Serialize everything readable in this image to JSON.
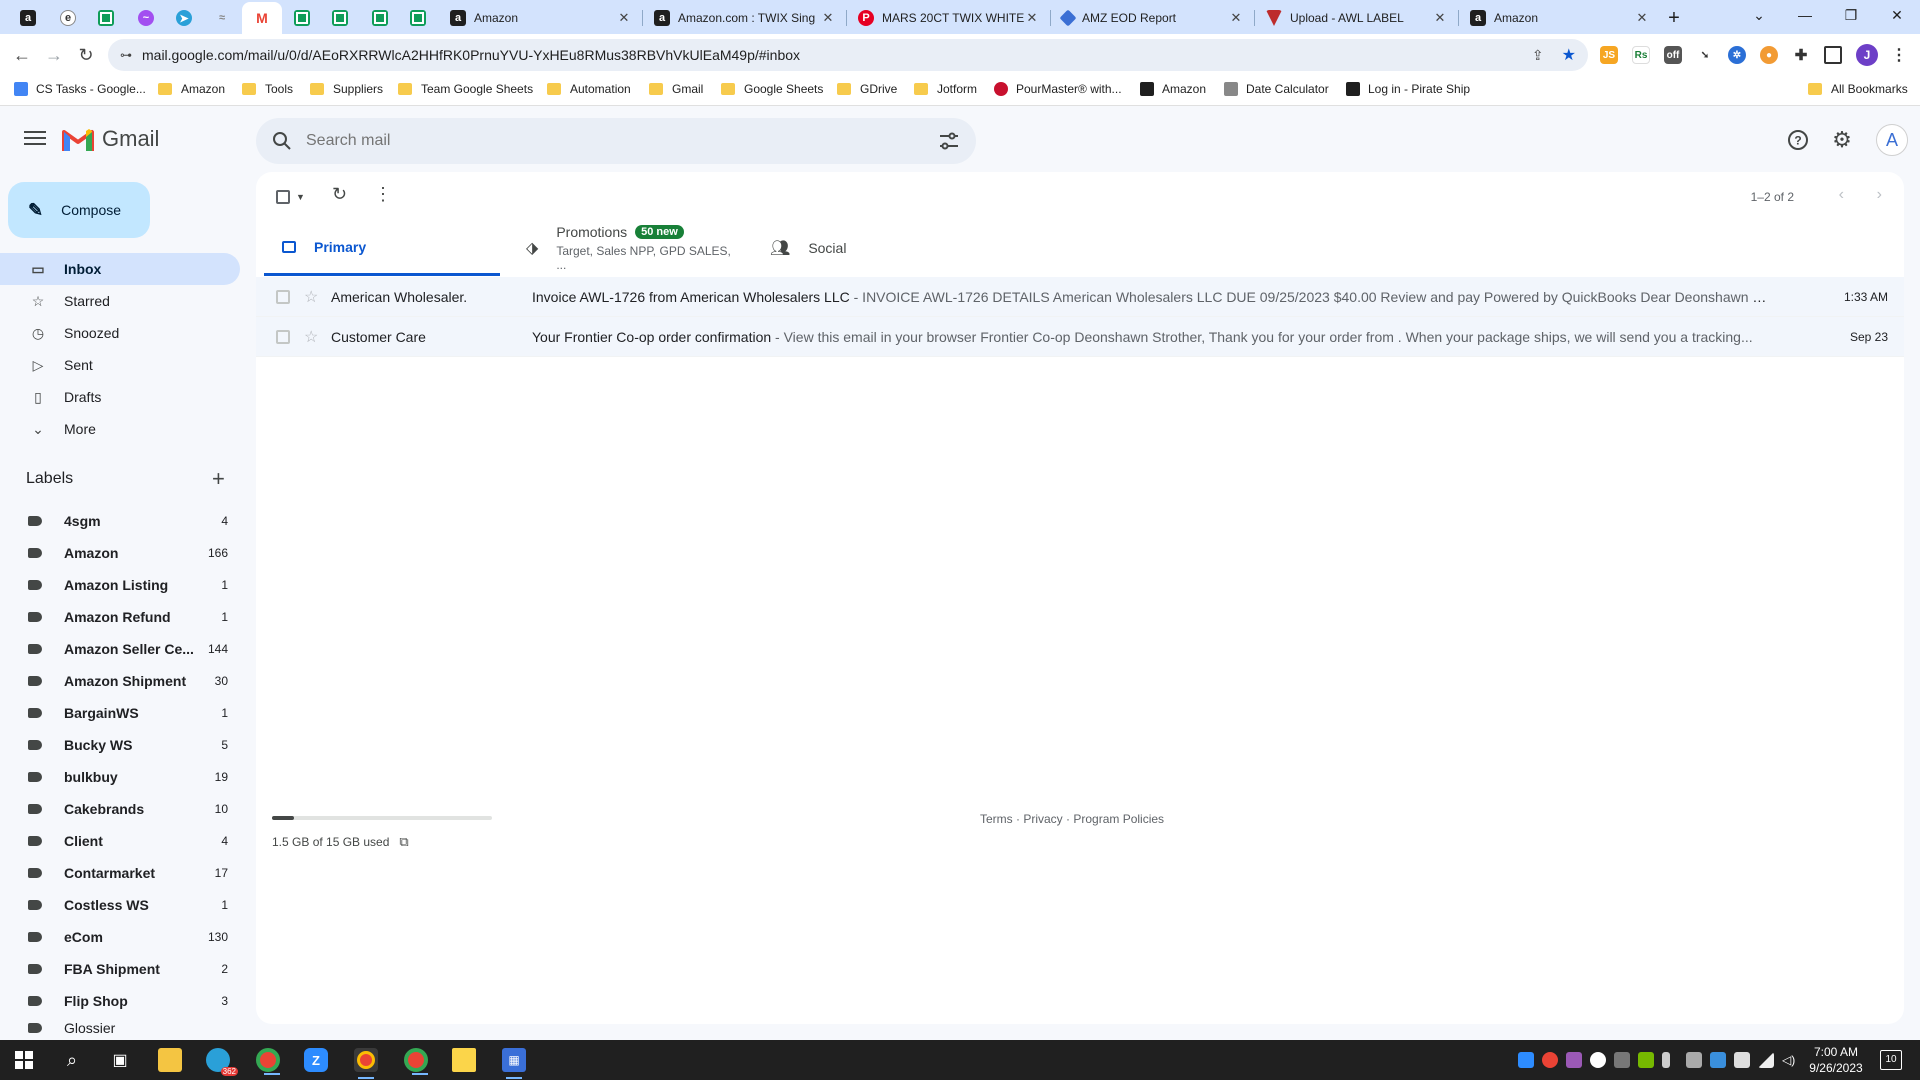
{
  "browser": {
    "tabs": [
      {
        "title": "Amazon",
        "icon": "amazon-icon"
      },
      {
        "title": "Amazon.com : TWIX Sing",
        "icon": "amazon-icon"
      },
      {
        "title": "MARS 20CT TWIX WHITE",
        "icon": "pinterest-icon"
      },
      {
        "title": "AMZ EOD Report",
        "icon": "amz-icon"
      },
      {
        "title": "Upload - AWL LABEL",
        "icon": "webform-icon"
      },
      {
        "title": "Amazon",
        "icon": "amazon-icon"
      }
    ],
    "url": "mail.google.com/mail/u/0/d/AEoRXRRWlcA2HHfRK0PrnuYVU-YxHEu8RMus38RBVhVkUlEaM49p/#inbox",
    "profile_initial": "J",
    "bookmarks": [
      {
        "label": "CS Tasks - Google...",
        "kind": "doc"
      },
      {
        "label": "Amazon",
        "kind": "folder"
      },
      {
        "label": "Tools",
        "kind": "folder"
      },
      {
        "label": "Suppliers",
        "kind": "folder"
      },
      {
        "label": "Team Google Sheets",
        "kind": "folder"
      },
      {
        "label": "Automation",
        "kind": "folder"
      },
      {
        "label": "Gmail",
        "kind": "folder"
      },
      {
        "label": "Google Sheets",
        "kind": "folder"
      },
      {
        "label": "GDrive",
        "kind": "folder"
      },
      {
        "label": "Jotform",
        "kind": "folder"
      },
      {
        "label": "PourMaster® with...",
        "kind": "site"
      },
      {
        "label": "Amazon",
        "kind": "amazon"
      },
      {
        "label": "Date Calculator",
        "kind": "calc"
      },
      {
        "label": "Log in - Pirate Ship",
        "kind": "pirate"
      }
    ],
    "all_bookmarks": "All Bookmarks"
  },
  "gmail": {
    "app_name": "Gmail",
    "search_placeholder": "Search mail",
    "avatar_initial": "A",
    "compose_label": "Compose",
    "nav": [
      {
        "label": "Inbox",
        "icon": "inbox-icon",
        "active": true
      },
      {
        "label": "Starred",
        "icon": "star-icon"
      },
      {
        "label": "Snoozed",
        "icon": "clock-icon"
      },
      {
        "label": "Sent",
        "icon": "send-icon"
      },
      {
        "label": "Drafts",
        "icon": "draft-icon"
      },
      {
        "label": "More",
        "icon": "chevron-down-icon"
      }
    ],
    "labels_heading": "Labels",
    "labels": [
      {
        "name": "4sgm",
        "count": "4"
      },
      {
        "name": "Amazon",
        "count": "166"
      },
      {
        "name": "Amazon Listing",
        "count": "1"
      },
      {
        "name": "Amazon Refund",
        "count": "1"
      },
      {
        "name": "Amazon Seller Ce...",
        "count": "144"
      },
      {
        "name": "Amazon Shipment",
        "count": "30"
      },
      {
        "name": "BargainWS",
        "count": "1"
      },
      {
        "name": "Bucky WS",
        "count": "5"
      },
      {
        "name": "bulkbuy",
        "count": "19"
      },
      {
        "name": "Cakebrands",
        "count": "10"
      },
      {
        "name": "Client",
        "count": "4"
      },
      {
        "name": "Contarmarket",
        "count": "17"
      },
      {
        "name": "Costless WS",
        "count": "1"
      },
      {
        "name": "eCom",
        "count": "130"
      },
      {
        "name": "FBA Shipment",
        "count": "2"
      },
      {
        "name": "Flip Shop",
        "count": "3"
      },
      {
        "name": "Glossier",
        "count": ""
      }
    ],
    "pager": "1–2 of 2",
    "tabs": {
      "primary": "Primary",
      "promotions": "Promotions",
      "promotions_badge": "50 new",
      "promotions_sub": "Target, Sales NPP, GPD SALES, ...",
      "social": "Social"
    },
    "emails": [
      {
        "sender": "American Wholesaler.",
        "subject": "Invoice AWL-1726 from American Wholesalers LLC",
        "snippet": " - INVOICE AWL-1726 DETAILS American Wholesalers LLC DUE 09/25/2023 $40.00 Review and pay Powered by QuickBooks Dear Deonshawn Str...",
        "date": "1:33 AM"
      },
      {
        "sender": "Customer Care",
        "subject": "Your Frontier Co-op order confirmation",
        "snippet": " - View this email in your browser Frontier Co-op Deonshawn Strother, Thank you for your order from . When your package ships, we will send you a tracking...",
        "date": "Sep 23"
      }
    ],
    "storage_text": "1.5 GB of 15 GB used",
    "storage_used_fraction": 0.1,
    "footer": {
      "terms": "Terms",
      "privacy": "Privacy",
      "policies": "Program Policies",
      "sep": " · "
    }
  },
  "taskbar": {
    "telegram_badge": "362",
    "time": "7:00 AM",
    "date": "9/26/2023",
    "notification_count": "10"
  }
}
